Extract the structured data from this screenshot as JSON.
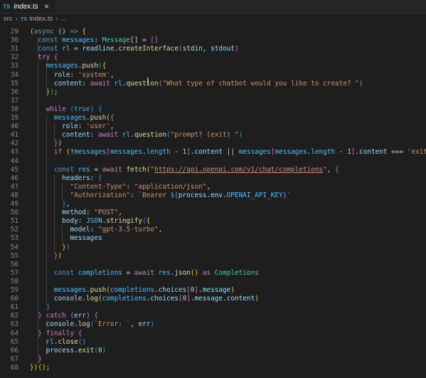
{
  "tab": {
    "icon_label": "TS",
    "filename": "index.ts",
    "close_glyph": "×"
  },
  "breadcrumb": {
    "folder": "src",
    "sep": "›",
    "icon_label": "TS",
    "file": "index.ts",
    "ellipsis": "..."
  },
  "lines": [
    {
      "n": "29",
      "segs": [
        [
          "(",
          "b1"
        ],
        [
          "async",
          "k"
        ],
        [
          " () "
        ],
        [
          "=>",
          "k"
        ],
        [
          " "
        ],
        [
          "{",
          "b1"
        ]
      ]
    },
    {
      "n": "30",
      "segs": [
        [
          "  "
        ],
        [
          "const",
          "k"
        ],
        [
          " "
        ],
        [
          "messages",
          "cst"
        ],
        [
          ": "
        ],
        [
          "Message",
          "t"
        ],
        [
          "[] = "
        ],
        [
          "[]",
          "b2"
        ]
      ]
    },
    {
      "n": "31",
      "segs": [
        [
          "  "
        ],
        [
          "const",
          "k"
        ],
        [
          " "
        ],
        [
          "rl",
          "cst"
        ],
        [
          " = "
        ],
        [
          "readline",
          "v"
        ],
        [
          "."
        ],
        [
          "createInterface",
          "f"
        ],
        [
          "(",
          "b2"
        ],
        [
          "stdin",
          "v"
        ],
        [
          ", "
        ],
        [
          "stdout",
          "v"
        ],
        [
          ")",
          "b2"
        ]
      ]
    },
    {
      "n": "32",
      "segs": [
        [
          "  "
        ],
        [
          "try",
          "c"
        ],
        [
          " "
        ],
        [
          "{",
          "b2"
        ]
      ]
    },
    {
      "n": "33",
      "segs": [
        [
          "    "
        ],
        [
          "messages",
          "cst"
        ],
        [
          "."
        ],
        [
          "push",
          "f"
        ],
        [
          "(",
          "b3"
        ],
        [
          "{",
          "b1"
        ]
      ]
    },
    {
      "n": "34",
      "segs": [
        [
          "      "
        ],
        [
          "role",
          "v"
        ],
        [
          ": "
        ],
        [
          "'system'",
          "s"
        ],
        [
          ","
        ]
      ]
    },
    {
      "n": "35",
      "segs": [
        [
          "      "
        ],
        [
          "content",
          "v"
        ],
        [
          ": "
        ],
        [
          "await",
          "c"
        ],
        [
          " "
        ],
        [
          "rl",
          "cst"
        ],
        [
          "."
        ],
        [
          "question",
          "f"
        ],
        [
          "(",
          "b2"
        ],
        [
          "\"What type of chatbot would you like to create? \"",
          "s"
        ],
        [
          ")",
          "b2"
        ]
      ]
    },
    {
      "n": "36",
      "segs": [
        [
          "    "
        ],
        [
          "}",
          "b1"
        ],
        [
          ")",
          "b3"
        ],
        [
          ";"
        ]
      ]
    },
    {
      "n": "37",
      "segs": []
    },
    {
      "n": "38",
      "segs": [
        [
          "    "
        ],
        [
          "while",
          "c"
        ],
        [
          " "
        ],
        [
          "(",
          "b3"
        ],
        [
          "true",
          "k"
        ],
        [
          ")",
          "b3"
        ],
        [
          " "
        ],
        [
          "{",
          "b3"
        ]
      ]
    },
    {
      "n": "39",
      "segs": [
        [
          "      "
        ],
        [
          "messages",
          "cst"
        ],
        [
          "."
        ],
        [
          "push",
          "f"
        ],
        [
          "(",
          "b1"
        ],
        [
          "{",
          "b2"
        ]
      ]
    },
    {
      "n": "40",
      "segs": [
        [
          "        "
        ],
        [
          "role",
          "v"
        ],
        [
          ": "
        ],
        [
          "'user'",
          "s"
        ],
        [
          ","
        ]
      ]
    },
    {
      "n": "41",
      "segs": [
        [
          "        "
        ],
        [
          "content",
          "v"
        ],
        [
          ": "
        ],
        [
          "await",
          "c"
        ],
        [
          " "
        ],
        [
          "rl",
          "cst"
        ],
        [
          "."
        ],
        [
          "question",
          "f"
        ],
        [
          "(",
          "b3"
        ],
        [
          "\"prompt? (exit) \"",
          "s"
        ],
        [
          ")",
          "b3"
        ]
      ]
    },
    {
      "n": "42",
      "segs": [
        [
          "      "
        ],
        [
          "}",
          "b2"
        ],
        [
          ")",
          "b1"
        ]
      ]
    },
    {
      "n": "43",
      "segs": [
        [
          "      "
        ],
        [
          "if",
          "c"
        ],
        [
          " "
        ],
        [
          "(",
          "b1"
        ],
        [
          "!"
        ],
        [
          "messages",
          "cst"
        ],
        [
          "[",
          "b2"
        ],
        [
          "messages",
          "cst"
        ],
        [
          "."
        ],
        [
          "length",
          "cst"
        ],
        [
          " - "
        ],
        [
          "1",
          "n"
        ],
        [
          "]",
          "b2"
        ],
        [
          "."
        ],
        [
          "content",
          "v"
        ],
        [
          " || "
        ],
        [
          "messages",
          "cst"
        ],
        [
          "[",
          "b2"
        ],
        [
          "messages",
          "cst"
        ],
        [
          "."
        ],
        [
          "length",
          "cst"
        ],
        [
          " - "
        ],
        [
          "1",
          "n"
        ],
        [
          "]",
          "b2"
        ],
        [
          "."
        ],
        [
          "content",
          "v"
        ],
        [
          " === "
        ],
        [
          "'exit'",
          "s"
        ],
        [
          ")",
          "b1"
        ],
        [
          " br"
        ]
      ]
    },
    {
      "n": "44",
      "segs": []
    },
    {
      "n": "45",
      "segs": [
        [
          "      "
        ],
        [
          "const",
          "k"
        ],
        [
          " "
        ],
        [
          "res",
          "cst"
        ],
        [
          " = "
        ],
        [
          "await",
          "c"
        ],
        [
          " "
        ],
        [
          "fetch",
          "f"
        ],
        [
          "(",
          "b1"
        ],
        [
          "\"",
          "s"
        ],
        [
          "https://api.openai.com/v1/chat/completions",
          "s u"
        ],
        [
          "\"",
          "s"
        ],
        [
          ", "
        ],
        [
          "{",
          "b2"
        ]
      ]
    },
    {
      "n": "46",
      "segs": [
        [
          "        "
        ],
        [
          "headers",
          "v"
        ],
        [
          ": "
        ],
        [
          "{",
          "b3"
        ]
      ]
    },
    {
      "n": "47",
      "segs": [
        [
          "          "
        ],
        [
          "\"Content-Type\"",
          "s"
        ],
        [
          ": "
        ],
        [
          "\"application/json\"",
          "s"
        ],
        [
          ","
        ]
      ]
    },
    {
      "n": "48",
      "segs": [
        [
          "          "
        ],
        [
          "\"Authorization\"",
          "s"
        ],
        [
          ": "
        ],
        [
          "`Bearer ",
          "s"
        ],
        [
          "${",
          "k"
        ],
        [
          "process",
          "v"
        ],
        [
          "."
        ],
        [
          "env",
          "v"
        ],
        [
          "."
        ],
        [
          "OPENAI_API_KEY",
          "cst"
        ],
        [
          "}",
          "k"
        ],
        [
          "`",
          "s"
        ]
      ]
    },
    {
      "n": "49",
      "segs": [
        [
          "        "
        ],
        [
          "}",
          "b3"
        ],
        [
          ","
        ]
      ]
    },
    {
      "n": "50",
      "segs": [
        [
          "        "
        ],
        [
          "method",
          "v"
        ],
        [
          ": "
        ],
        [
          "\"POST\"",
          "s"
        ],
        [
          ","
        ]
      ]
    },
    {
      "n": "51",
      "segs": [
        [
          "        "
        ],
        [
          "body",
          "v"
        ],
        [
          ": "
        ],
        [
          "JSON",
          "cst"
        ],
        [
          "."
        ],
        [
          "stringify",
          "f"
        ],
        [
          "(",
          "b3"
        ],
        [
          "{",
          "b1"
        ]
      ]
    },
    {
      "n": "52",
      "segs": [
        [
          "          "
        ],
        [
          "model",
          "v"
        ],
        [
          ": "
        ],
        [
          "\"gpt-3.5-turbo\"",
          "s"
        ],
        [
          ","
        ]
      ]
    },
    {
      "n": "53",
      "segs": [
        [
          "          "
        ],
        [
          "messages",
          "v"
        ]
      ]
    },
    {
      "n": "54",
      "segs": [
        [
          "        "
        ],
        [
          "}",
          "b1"
        ],
        [
          ")",
          "b3"
        ]
      ]
    },
    {
      "n": "55",
      "segs": [
        [
          "      "
        ],
        [
          "}",
          "b2"
        ],
        [
          ")",
          "b1"
        ]
      ]
    },
    {
      "n": "56",
      "segs": []
    },
    {
      "n": "57",
      "segs": [
        [
          "      "
        ],
        [
          "const",
          "k"
        ],
        [
          " "
        ],
        [
          "completions",
          "cst"
        ],
        [
          " = "
        ],
        [
          "await",
          "c"
        ],
        [
          " "
        ],
        [
          "res",
          "cst"
        ],
        [
          "."
        ],
        [
          "json",
          "f"
        ],
        [
          "()",
          "b1"
        ],
        [
          " "
        ],
        [
          "as",
          "c"
        ],
        [
          " "
        ],
        [
          "Completions",
          "t"
        ]
      ]
    },
    {
      "n": "58",
      "segs": []
    },
    {
      "n": "59",
      "segs": [
        [
          "      "
        ],
        [
          "messages",
          "cst"
        ],
        [
          "."
        ],
        [
          "push",
          "f"
        ],
        [
          "(",
          "b1"
        ],
        [
          "completions",
          "cst"
        ],
        [
          "."
        ],
        [
          "choices",
          "v"
        ],
        [
          "[",
          "b2"
        ],
        [
          "0",
          "n"
        ],
        [
          "]",
          "b2"
        ],
        [
          "."
        ],
        [
          "message",
          "v"
        ],
        [
          ")",
          "b1"
        ]
      ]
    },
    {
      "n": "60",
      "segs": [
        [
          "      "
        ],
        [
          "console",
          "v"
        ],
        [
          "."
        ],
        [
          "log",
          "f"
        ],
        [
          "(",
          "b1"
        ],
        [
          "completions",
          "cst"
        ],
        [
          "."
        ],
        [
          "choices",
          "v"
        ],
        [
          "[",
          "b2"
        ],
        [
          "0",
          "n"
        ],
        [
          "]",
          "b2"
        ],
        [
          "."
        ],
        [
          "message",
          "v"
        ],
        [
          "."
        ],
        [
          "content",
          "v"
        ],
        [
          ")",
          "b1"
        ]
      ]
    },
    {
      "n": "61",
      "segs": [
        [
          "    "
        ],
        [
          "}",
          "b3"
        ]
      ]
    },
    {
      "n": "62",
      "segs": [
        [
          "  "
        ],
        [
          "}",
          "b2"
        ],
        [
          " "
        ],
        [
          "catch",
          "c"
        ],
        [
          " "
        ],
        [
          "(",
          "b2"
        ],
        [
          "err",
          "v"
        ],
        [
          ")",
          "b2"
        ],
        [
          " "
        ],
        [
          "{",
          "b2"
        ]
      ]
    },
    {
      "n": "63",
      "segs": [
        [
          "    "
        ],
        [
          "console",
          "v"
        ],
        [
          "."
        ],
        [
          "log",
          "f"
        ],
        [
          "(",
          "b3"
        ],
        [
          "`Error: `",
          "s"
        ],
        [
          ", "
        ],
        [
          "err",
          "v"
        ],
        [
          ")",
          "b3"
        ]
      ]
    },
    {
      "n": "64",
      "segs": [
        [
          "  "
        ],
        [
          "}",
          "b2"
        ],
        [
          " "
        ],
        [
          "finally",
          "c"
        ],
        [
          " "
        ],
        [
          "{",
          "b2"
        ]
      ]
    },
    {
      "n": "65",
      "segs": [
        [
          "    "
        ],
        [
          "rl",
          "cst"
        ],
        [
          "."
        ],
        [
          "close",
          "f"
        ],
        [
          "()",
          "b3"
        ]
      ]
    },
    {
      "n": "66",
      "segs": [
        [
          "    "
        ],
        [
          "process",
          "v"
        ],
        [
          "."
        ],
        [
          "exit",
          "f"
        ],
        [
          "(",
          "b3"
        ],
        [
          "0",
          "n"
        ],
        [
          ")",
          "b3"
        ]
      ]
    },
    {
      "n": "67",
      "segs": [
        [
          "  "
        ],
        [
          "}",
          "b2"
        ]
      ]
    },
    {
      "n": "68",
      "segs": [
        [
          "}",
          "b1"
        ],
        [
          ")",
          "b1"
        ],
        [
          "()",
          "b1"
        ],
        [
          ";"
        ]
      ]
    }
  ]
}
